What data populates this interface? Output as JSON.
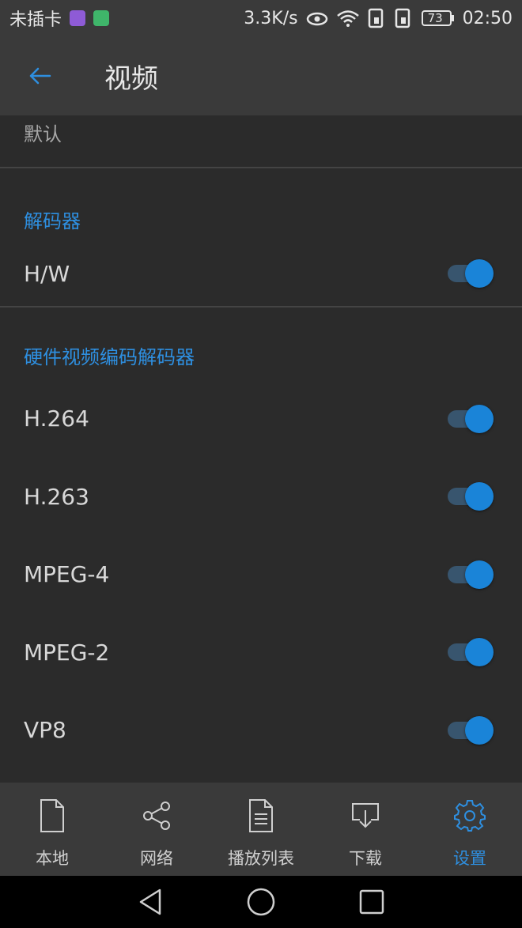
{
  "status_bar": {
    "carrier": "未插卡",
    "net_speed": "3.3K/s",
    "battery": "73",
    "time": "02:50"
  },
  "app_bar": {
    "title": "视频"
  },
  "content": {
    "default_value": "默认",
    "sections": [
      {
        "title": "解码器",
        "items": [
          {
            "label": "H/W",
            "enabled": true
          }
        ]
      },
      {
        "title": "硬件视频编码解码器",
        "items": [
          {
            "label": "H.264",
            "enabled": true
          },
          {
            "label": "H.263",
            "enabled": true
          },
          {
            "label": "MPEG-4",
            "enabled": true
          },
          {
            "label": "MPEG-2",
            "enabled": true
          },
          {
            "label": "VP8",
            "enabled": true
          }
        ]
      }
    ]
  },
  "bottom_nav": {
    "items": [
      {
        "label": "本地",
        "icon": "file-icon"
      },
      {
        "label": "网络",
        "icon": "share-icon"
      },
      {
        "label": "播放列表",
        "icon": "playlist-icon"
      },
      {
        "label": "下载",
        "icon": "download-icon"
      },
      {
        "label": "设置",
        "icon": "gear-icon",
        "active": true
      }
    ]
  },
  "colors": {
    "accent": "#2e8fe0",
    "toggle_thumb": "#1a84d8",
    "background": "#2b2b2b",
    "bar": "#3a3a3a"
  }
}
